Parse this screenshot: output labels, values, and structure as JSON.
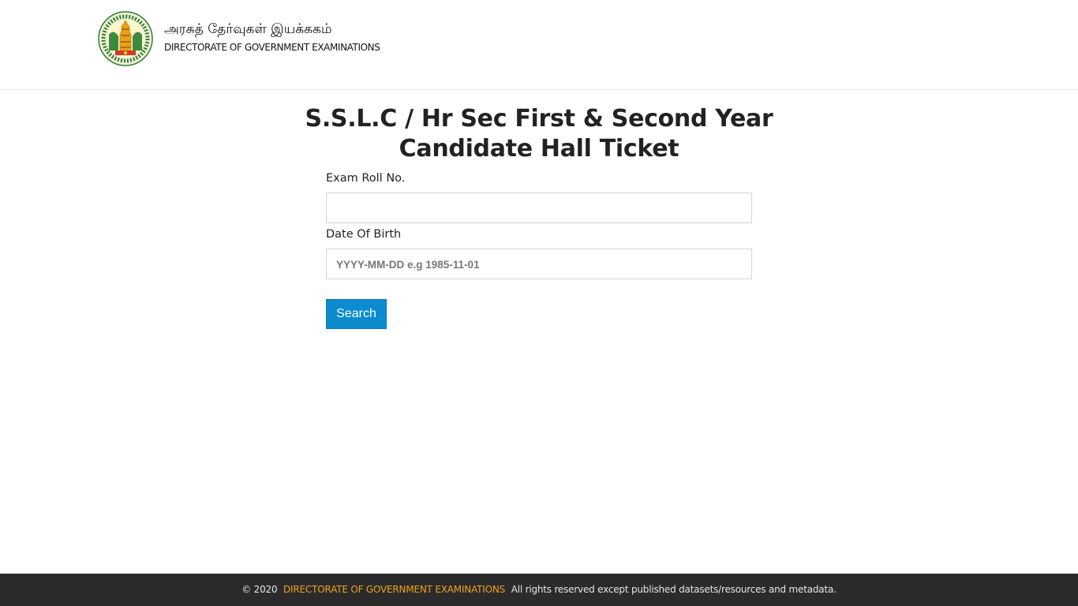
{
  "header": {
    "logo_icon": "tamil-nadu-emblem-icon",
    "brand_tamil": "அரசுத் தேர்வுகள் இயக்ககம்",
    "brand_english": "DIRECTORATE OF GOVERNMENT EXAMINATIONS"
  },
  "form": {
    "title_line1": "S.S.L.C / Hr Sec First & Second Year",
    "title_line2": "Candidate Hall Ticket",
    "roll_label": "Exam Roll No.",
    "roll_value": "",
    "roll_placeholder": "",
    "dob_label": "Date Of Birth",
    "dob_value": "",
    "dob_placeholder": "YYYY-MM-DD e.g 1985-11-01",
    "search_label": "Search"
  },
  "footer": {
    "copyright": "© 2020",
    "org_link": "DIRECTORATE OF GOVERNMENT EXAMINATIONS",
    "rights": "All rights reserved except published datasets/resources and metadata."
  },
  "colors": {
    "button": "#0a8ccf",
    "footer_bg": "#2b2b2b",
    "footer_link": "#f0a21c"
  }
}
